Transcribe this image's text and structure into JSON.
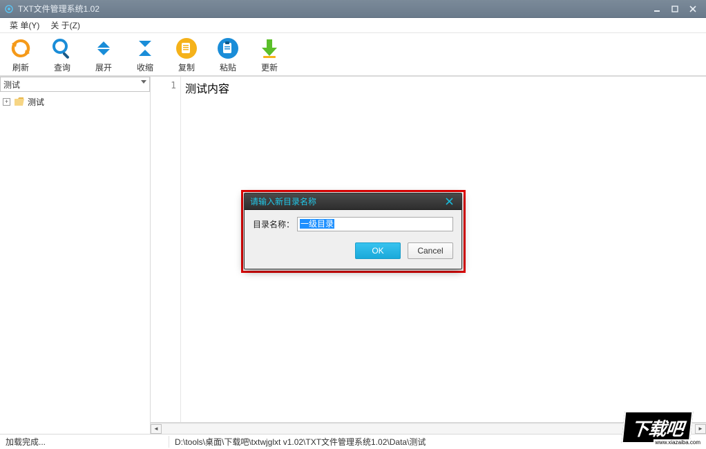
{
  "window": {
    "title": "TXT文件管理系统1.02"
  },
  "menu": {
    "item1": "菜 单(Y)",
    "item2": "关 于(Z)"
  },
  "toolbar": {
    "refresh": "刷新",
    "search": "查询",
    "expand": "展开",
    "collapse": "收缩",
    "copy": "复制",
    "paste": "粘贴",
    "update": "更新"
  },
  "sidebar": {
    "combo_value": "测试",
    "tree": {
      "node1": "测试"
    }
  },
  "editor": {
    "line_number": "1",
    "line1": "测试内容"
  },
  "dialog": {
    "title": "请输入新目录名称",
    "label": "目录名称：",
    "value": "一级目录",
    "ok": "OK",
    "cancel": "Cancel"
  },
  "status": {
    "left": "加载完成...",
    "path": "D:\\tools\\桌面\\下载吧\\txtwjglxt v1.02\\TXT文件管理系统1.02\\Data\\测试"
  },
  "watermark": {
    "text": "下载吧",
    "url": "www.xiazaiba.com"
  }
}
